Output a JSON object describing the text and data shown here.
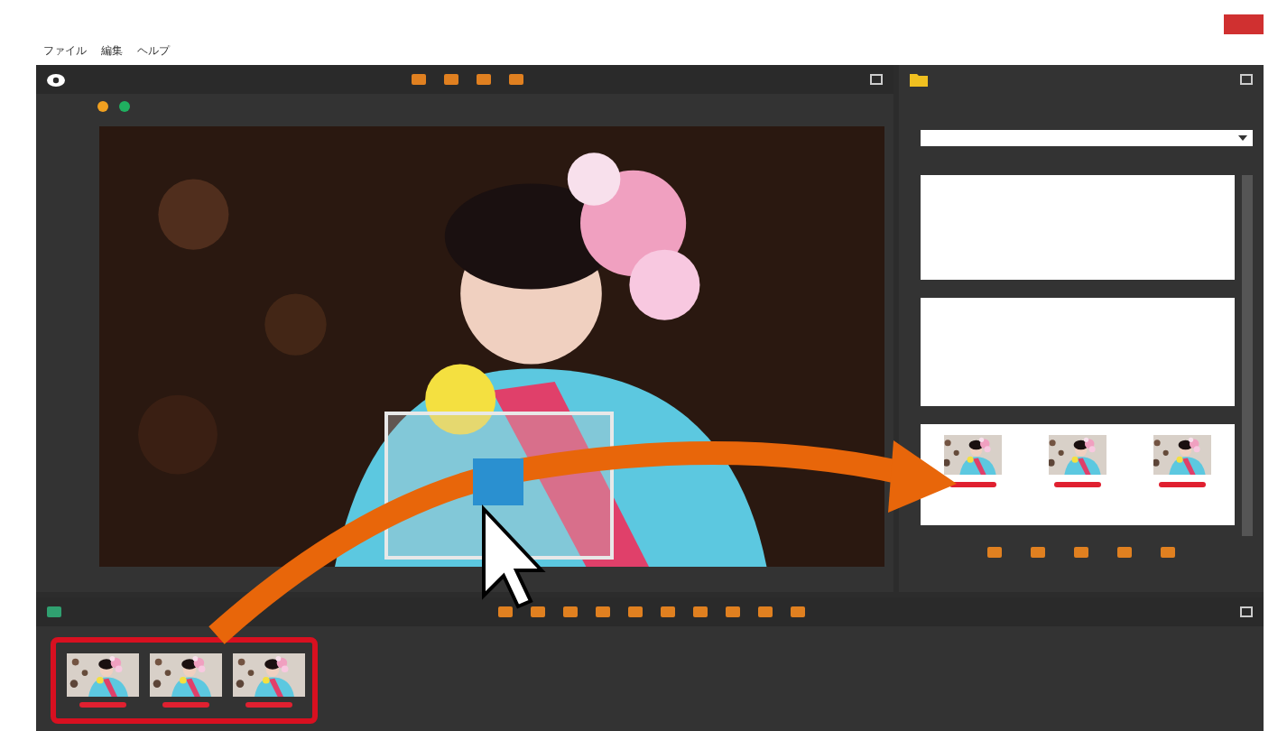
{
  "window": {
    "menu": [
      {
        "label": "ファイル"
      },
      {
        "label": "編集"
      },
      {
        "label": "ヘルプ"
      }
    ]
  },
  "viewer": {
    "color_labels": [
      {
        "color": "#f0a020"
      },
      {
        "color": "#20b060"
      }
    ]
  },
  "filmstrip": {
    "highlighted": true
  }
}
